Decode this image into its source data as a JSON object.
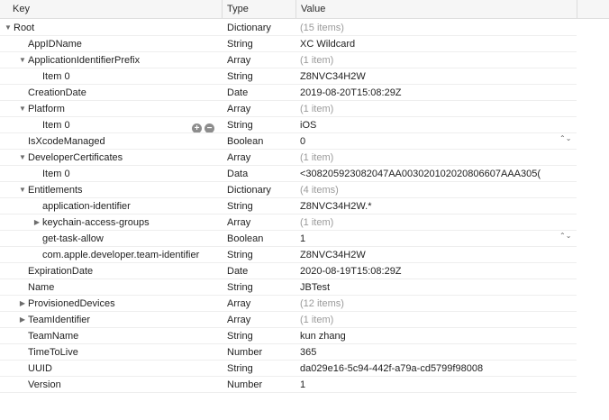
{
  "header": {
    "key_label": "Key",
    "type_label": "Type",
    "value_label": "Value"
  },
  "icons": {
    "expanded": "▼",
    "collapsed": "▶",
    "stepper": "⌃⌄",
    "add": "+",
    "remove": "−"
  },
  "rows": [
    {
      "key": "Root",
      "type": "Dictionary",
      "value": "(15 items)",
      "indent": 0,
      "disclosure": "expanded",
      "muted": true
    },
    {
      "key": "AppIDName",
      "type": "String",
      "value": "XC Wildcard",
      "indent": 1,
      "disclosure": "none",
      "muted": false
    },
    {
      "key": "ApplicationIdentifierPrefix",
      "type": "Array",
      "value": "(1 item)",
      "indent": 1,
      "disclosure": "expanded",
      "muted": true
    },
    {
      "key": "Item 0",
      "type": "String",
      "value": "Z8NVC34H2W",
      "indent": 2,
      "disclosure": "none",
      "muted": false
    },
    {
      "key": "CreationDate",
      "type": "Date",
      "value": "2019-08-20T15:08:29Z",
      "indent": 1,
      "disclosure": "none",
      "muted": false
    },
    {
      "key": "Platform",
      "type": "Array",
      "value": "(1 item)",
      "indent": 1,
      "disclosure": "expanded",
      "muted": true
    },
    {
      "key": "Item 0",
      "type": "String",
      "value": "iOS",
      "indent": 2,
      "disclosure": "none",
      "muted": false,
      "tools": true
    },
    {
      "key": "IsXcodeManaged",
      "type": "Boolean",
      "value": "0",
      "indent": 1,
      "disclosure": "none",
      "muted": false,
      "stepper": true
    },
    {
      "key": "DeveloperCertificates",
      "type": "Array",
      "value": "(1 item)",
      "indent": 1,
      "disclosure": "expanded",
      "muted": true
    },
    {
      "key": "Item 0",
      "type": "Data",
      "value": "<308205923082047AA003020102020806607AAA305(",
      "indent": 2,
      "disclosure": "none",
      "muted": false
    },
    {
      "key": "Entitlements",
      "type": "Dictionary",
      "value": "(4 items)",
      "indent": 1,
      "disclosure": "expanded",
      "muted": true
    },
    {
      "key": "application-identifier",
      "type": "String",
      "value": "Z8NVC34H2W.*",
      "indent": 2,
      "disclosure": "none",
      "muted": false
    },
    {
      "key": "keychain-access-groups",
      "type": "Array",
      "value": "(1 item)",
      "indent": 2,
      "disclosure": "collapsed",
      "muted": true
    },
    {
      "key": "get-task-allow",
      "type": "Boolean",
      "value": "1",
      "indent": 2,
      "disclosure": "none",
      "muted": false,
      "stepper": true
    },
    {
      "key": "com.apple.developer.team-identifier",
      "type": "String",
      "value": "Z8NVC34H2W",
      "indent": 2,
      "disclosure": "none",
      "muted": false
    },
    {
      "key": "ExpirationDate",
      "type": "Date",
      "value": "2020-08-19T15:08:29Z",
      "indent": 1,
      "disclosure": "none",
      "muted": false
    },
    {
      "key": "Name",
      "type": "String",
      "value": "JBTest",
      "indent": 1,
      "disclosure": "none",
      "muted": false
    },
    {
      "key": "ProvisionedDevices",
      "type": "Array",
      "value": "(12 items)",
      "indent": 1,
      "disclosure": "collapsed",
      "muted": true
    },
    {
      "key": "TeamIdentifier",
      "type": "Array",
      "value": "(1 item)",
      "indent": 1,
      "disclosure": "collapsed",
      "muted": true
    },
    {
      "key": "TeamName",
      "type": "String",
      "value": "kun zhang",
      "indent": 1,
      "disclosure": "none",
      "muted": false
    },
    {
      "key": "TimeToLive",
      "type": "Number",
      "value": "365",
      "indent": 1,
      "disclosure": "none",
      "muted": false
    },
    {
      "key": "UUID",
      "type": "String",
      "value": "da029e16-5c94-442f-a79a-cd5799f98008",
      "indent": 1,
      "disclosure": "none",
      "muted": false
    },
    {
      "key": "Version",
      "type": "Number",
      "value": "1",
      "indent": 1,
      "disclosure": "none",
      "muted": false
    }
  ]
}
